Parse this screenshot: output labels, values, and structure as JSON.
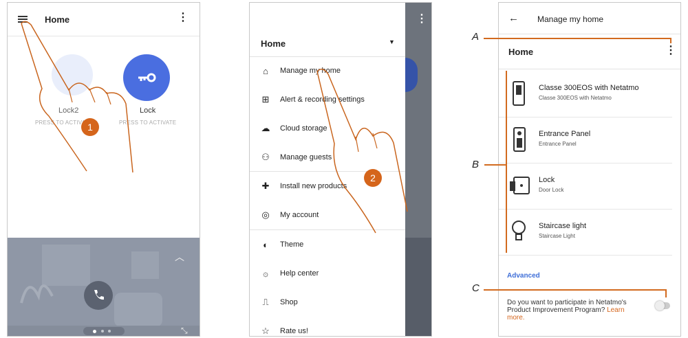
{
  "screen1": {
    "title": "Home",
    "menu_icon": "hamburger-icon",
    "more_icon": "more-vertical-icon",
    "tiles": [
      {
        "label": "Lock2",
        "sub": "PRESS TO ACTIVATE"
      },
      {
        "label": "Lock",
        "sub": "PRESS TO ACTIVATE"
      }
    ],
    "step": "1",
    "colors": {
      "accent": "#4a6ee0",
      "step_badge": "#d5651b"
    }
  },
  "screen2": {
    "home_label": "Home",
    "menu": [
      {
        "icon": "house-icon",
        "label": "Manage my home"
      },
      {
        "icon": "alert-settings-icon",
        "label": "Alert & recording settings"
      },
      {
        "icon": "cloud-upload-icon",
        "label": "Cloud storage"
      },
      {
        "icon": "guests-icon",
        "label": "Manage guests"
      },
      {
        "icon": "plus-cross-icon",
        "label": "Install new products"
      },
      {
        "icon": "account-icon",
        "label": "My account"
      },
      {
        "icon": "theme-icon",
        "label": "Theme"
      },
      {
        "icon": "help-icon",
        "label": "Help center"
      },
      {
        "icon": "shop-icon",
        "label": "Shop"
      },
      {
        "icon": "star-icon",
        "label": "Rate us!"
      }
    ],
    "step": "2"
  },
  "screen3": {
    "back_icon": "arrow-left-icon",
    "title": "Manage my home",
    "home_label": "Home",
    "devices": [
      {
        "name": "Classe 300EOS with Netatmo",
        "sub": "Classe 300EOS with Netatmo",
        "icon": "intercom-icon"
      },
      {
        "name": "Entrance Panel",
        "sub": "Entrance Panel",
        "icon": "entrance-panel-icon"
      },
      {
        "name": "Lock",
        "sub": "Door Lock",
        "icon": "door-lock-icon"
      },
      {
        "name": "Staircase light",
        "sub": "Staircase Light",
        "icon": "bulb-icon"
      }
    ],
    "advanced": "Advanced",
    "program_text": "Do you want to participate in Netatmo's Product Improvement Program?",
    "learn_more": "Learn more."
  },
  "callouts": {
    "a": "A",
    "b": "B",
    "c": "C"
  }
}
